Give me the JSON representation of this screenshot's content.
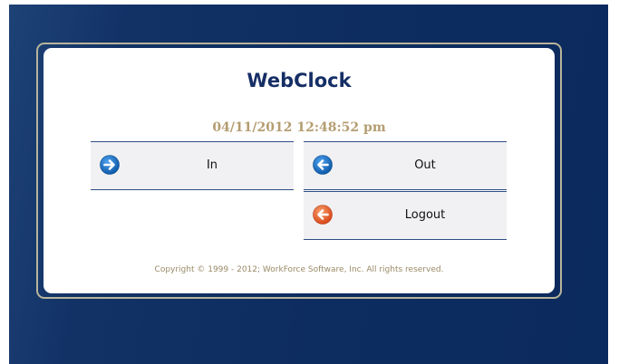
{
  "app": {
    "title": "WebClock",
    "datetime": "04/11/2012 12:48:52 pm"
  },
  "buttons": {
    "in": {
      "label": "In",
      "icon": "arrow-right-icon",
      "color": "#1a6ec2"
    },
    "out": {
      "label": "Out",
      "icon": "arrow-left-icon",
      "color": "#1a6ec2"
    },
    "logout": {
      "label": "Logout",
      "icon": "arrow-left-icon",
      "color": "#e8622a"
    }
  },
  "footer": {
    "copyright": "Copyright © 1999 - 2012; WorkForce Software, Inc.  All rights reserved."
  }
}
